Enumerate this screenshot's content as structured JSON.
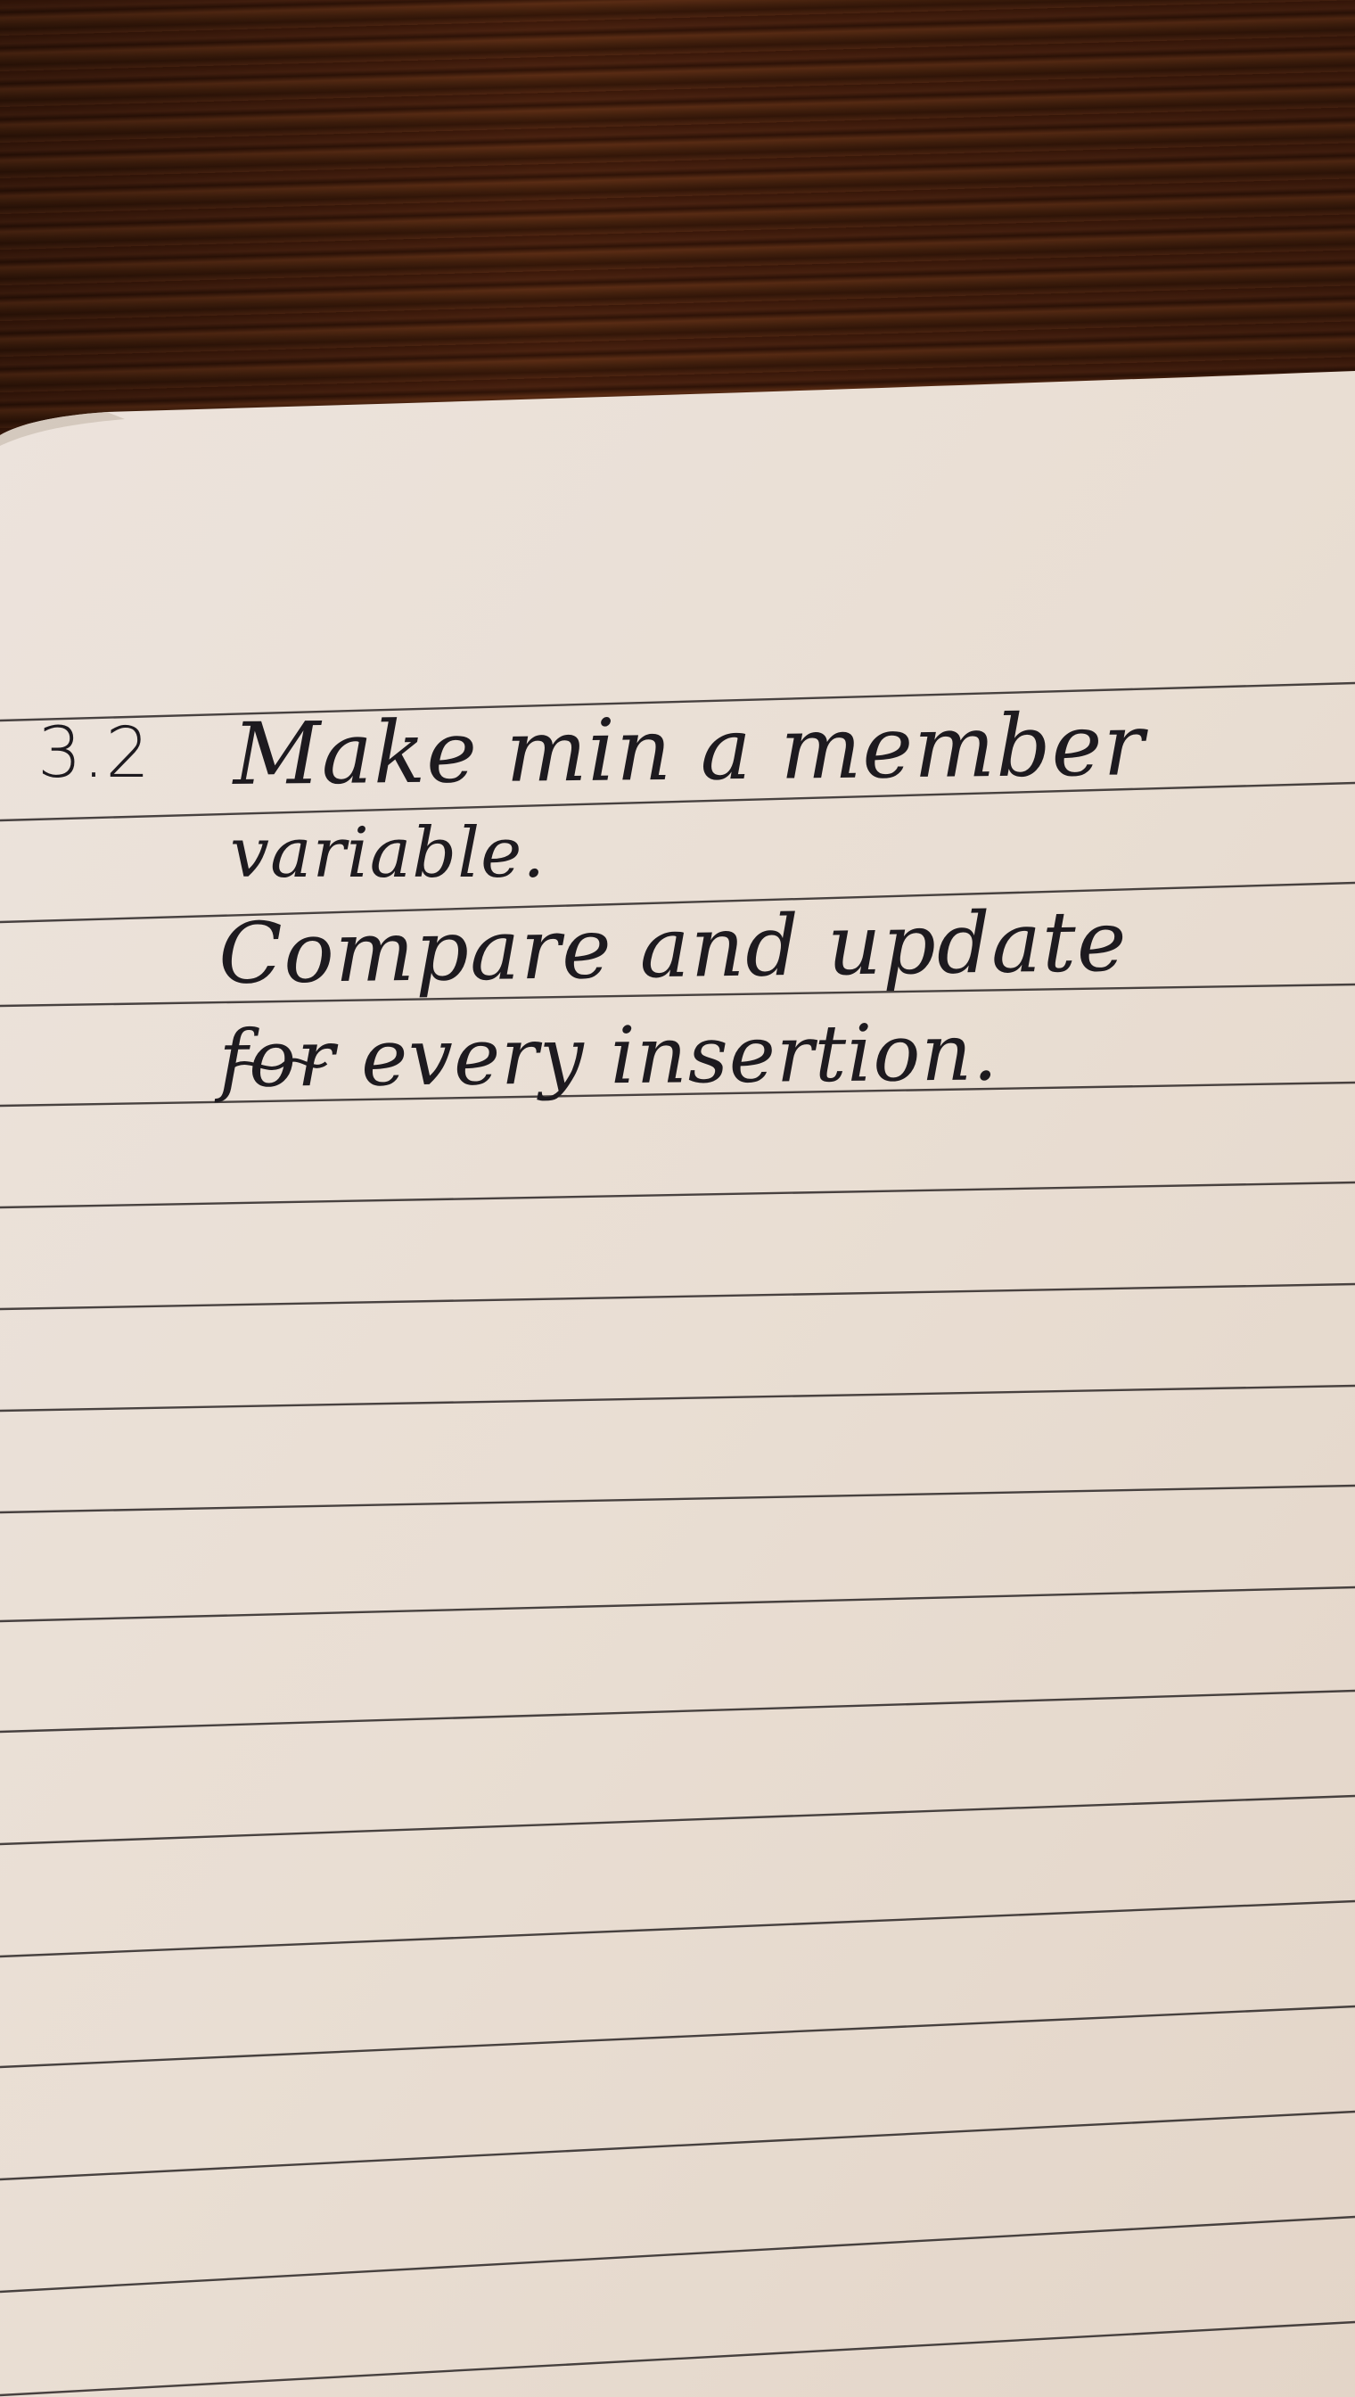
{
  "colors": {
    "table_wood": "#3b1809",
    "paper": "#ece2d8",
    "rule_line": "#2b2626",
    "ink": "#1d1a1f"
  },
  "note": {
    "number": "3.2",
    "lines": [
      "Make min a member",
      "variable.",
      "Compare and update",
      "for every insertion."
    ]
  }
}
